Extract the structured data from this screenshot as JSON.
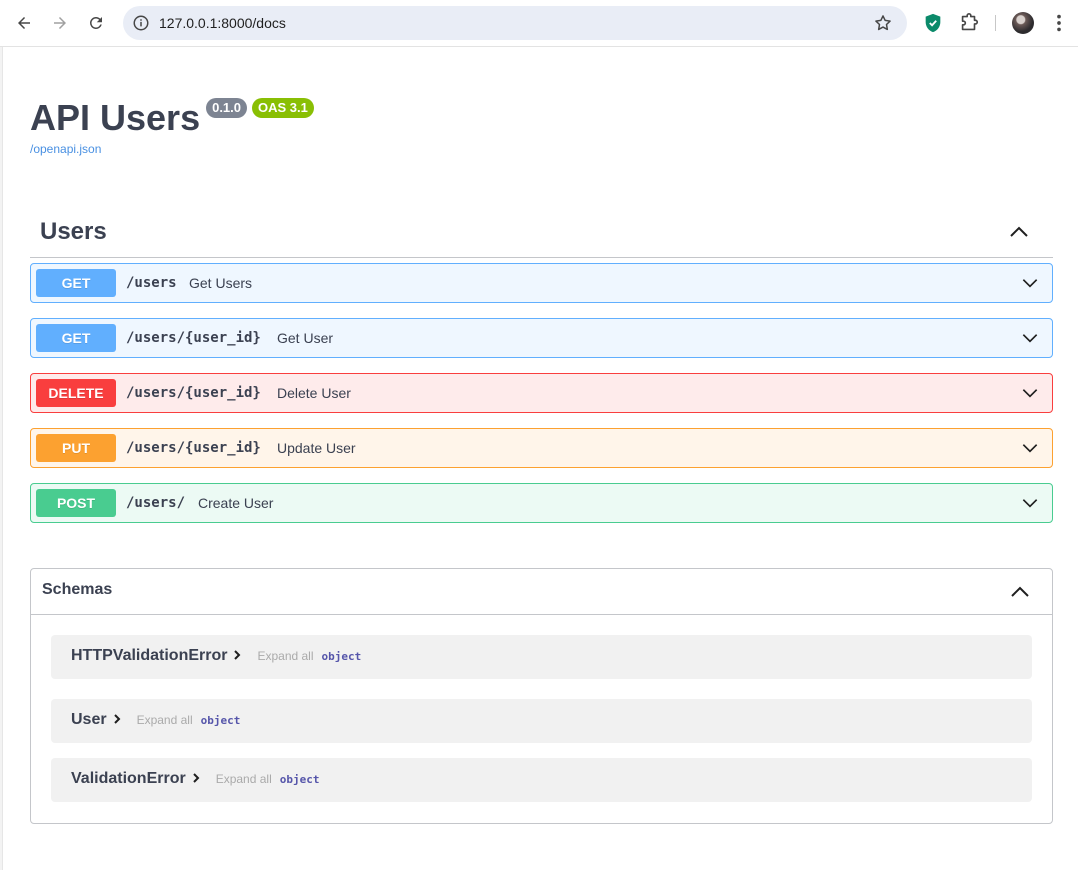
{
  "browser": {
    "url": "127.0.0.1:8000/docs"
  },
  "api": {
    "title": "API Users",
    "version": "0.1.0",
    "oas": "OAS 3.1",
    "spec_link": "/openapi.json"
  },
  "tag": {
    "name": "Users"
  },
  "operations": [
    {
      "method": "GET",
      "path": "/users",
      "summary": "Get Users"
    },
    {
      "method": "GET",
      "path": "/users/{user_id}",
      "summary": "Get User"
    },
    {
      "method": "DELETE",
      "path": "/users/{user_id}",
      "summary": "Delete User"
    },
    {
      "method": "PUT",
      "path": "/users/{user_id}",
      "summary": "Update User"
    },
    {
      "method": "POST",
      "path": "/users/",
      "summary": "Create User"
    }
  ],
  "schemas": {
    "title": "Schemas",
    "items": [
      {
        "name": "HTTPValidationError",
        "expand": "Expand all",
        "type": "object"
      },
      {
        "name": "User",
        "expand": "Expand all",
        "type": "object"
      },
      {
        "name": "ValidationError",
        "expand": "Expand all",
        "type": "object"
      }
    ]
  },
  "colors": {
    "get": "#61affe",
    "delete": "#f93e3e",
    "put": "#fca130",
    "post": "#49cc90",
    "oas_badge": "#89bf04",
    "version_badge": "#7d8492"
  }
}
